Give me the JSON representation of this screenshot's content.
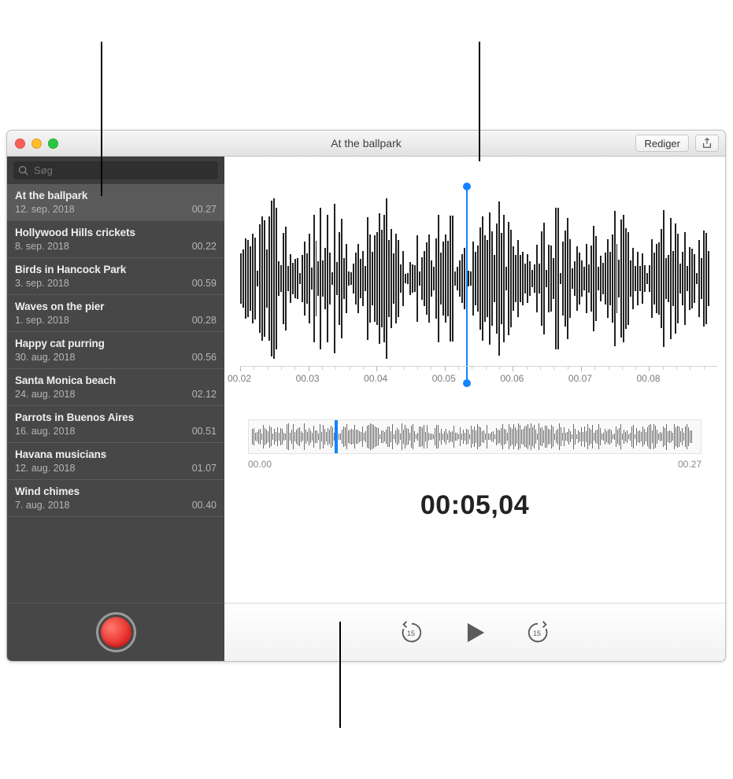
{
  "window": {
    "title": "At the ballpark"
  },
  "toolbar": {
    "edit": "Rediger"
  },
  "search": {
    "placeholder": "Søg"
  },
  "recordings": [
    {
      "title": "At the ballpark",
      "date": "12. sep. 2018",
      "dur": "00.27",
      "selected": true
    },
    {
      "title": "Hollywood Hills crickets",
      "date": "8. sep. 2018",
      "dur": "00.22",
      "selected": false
    },
    {
      "title": "Birds in Hancock Park",
      "date": "3. sep. 2018",
      "dur": "00.59",
      "selected": false
    },
    {
      "title": "Waves on the pier",
      "date": "1. sep. 2018",
      "dur": "00.28",
      "selected": false
    },
    {
      "title": "Happy cat purring",
      "date": "30. aug. 2018",
      "dur": "00.56",
      "selected": false
    },
    {
      "title": "Santa Monica beach",
      "date": "24. aug. 2018",
      "dur": "02.12",
      "selected": false
    },
    {
      "title": "Parrots in Buenos Aires",
      "date": "16. aug. 2018",
      "dur": "00.51",
      "selected": false
    },
    {
      "title": "Havana musicians",
      "date": "12. aug. 2018",
      "dur": "01.07",
      "selected": false
    },
    {
      "title": "Wind chimes",
      "date": "7. aug. 2018",
      "dur": "00.40",
      "selected": false
    }
  ],
  "waveform": {
    "ticks": [
      "00.02",
      "00.03",
      "00.04",
      "00.05",
      "00.06",
      "00.07",
      "00.08"
    ],
    "playhead_pct": 48
  },
  "overview": {
    "start": "00.00",
    "end": "00.27",
    "playhead_pct": 19
  },
  "timecode": "00:05,04",
  "skip": {
    "back": "15",
    "fwd": "15"
  }
}
